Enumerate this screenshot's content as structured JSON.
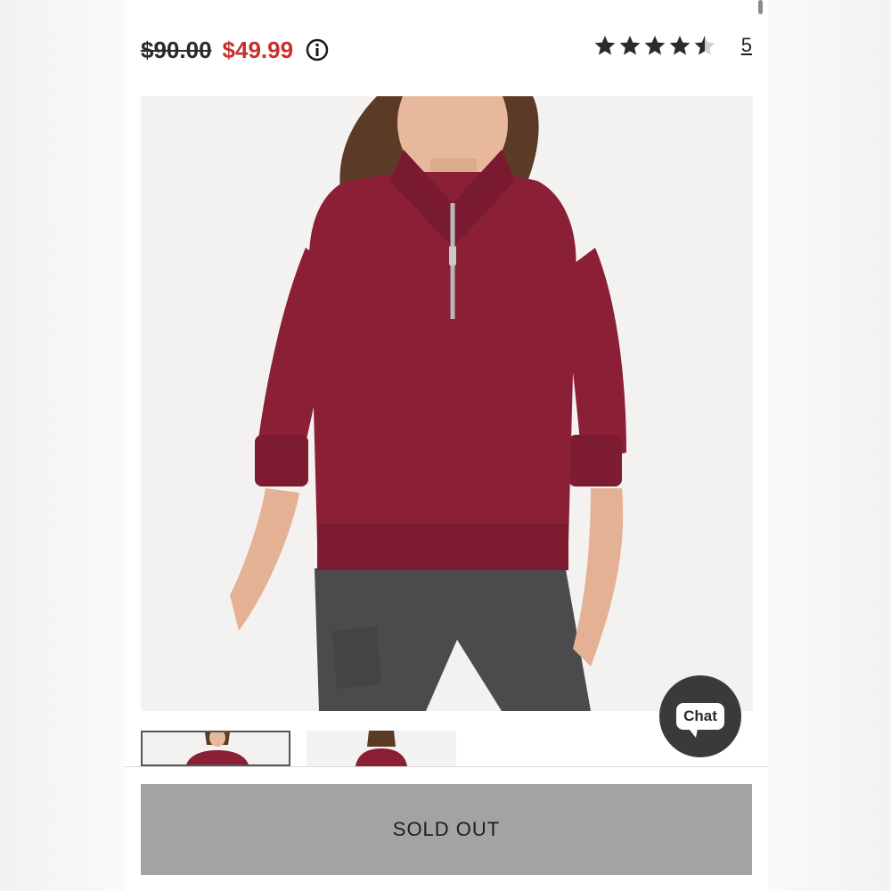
{
  "product": {
    "original_price": "$90.00",
    "sale_price": "$49.99",
    "rating_value": 4.5,
    "rating_max": 5,
    "review_count": "5"
  },
  "icons": {
    "info": "info-circle-icon",
    "star": "star-icon",
    "chat": "chat-bubble-icon"
  },
  "images": {
    "main_alt": "",
    "thumbnails": 2
  },
  "actions": {
    "sold_out_label": "SOLD OUT",
    "chat_label": "Chat"
  },
  "colors": {
    "sale_price": "#c8312b",
    "sweater": "#8a1f36",
    "button_disabled": "#a3a3a3",
    "chat_bg": "#3a3a3a"
  }
}
